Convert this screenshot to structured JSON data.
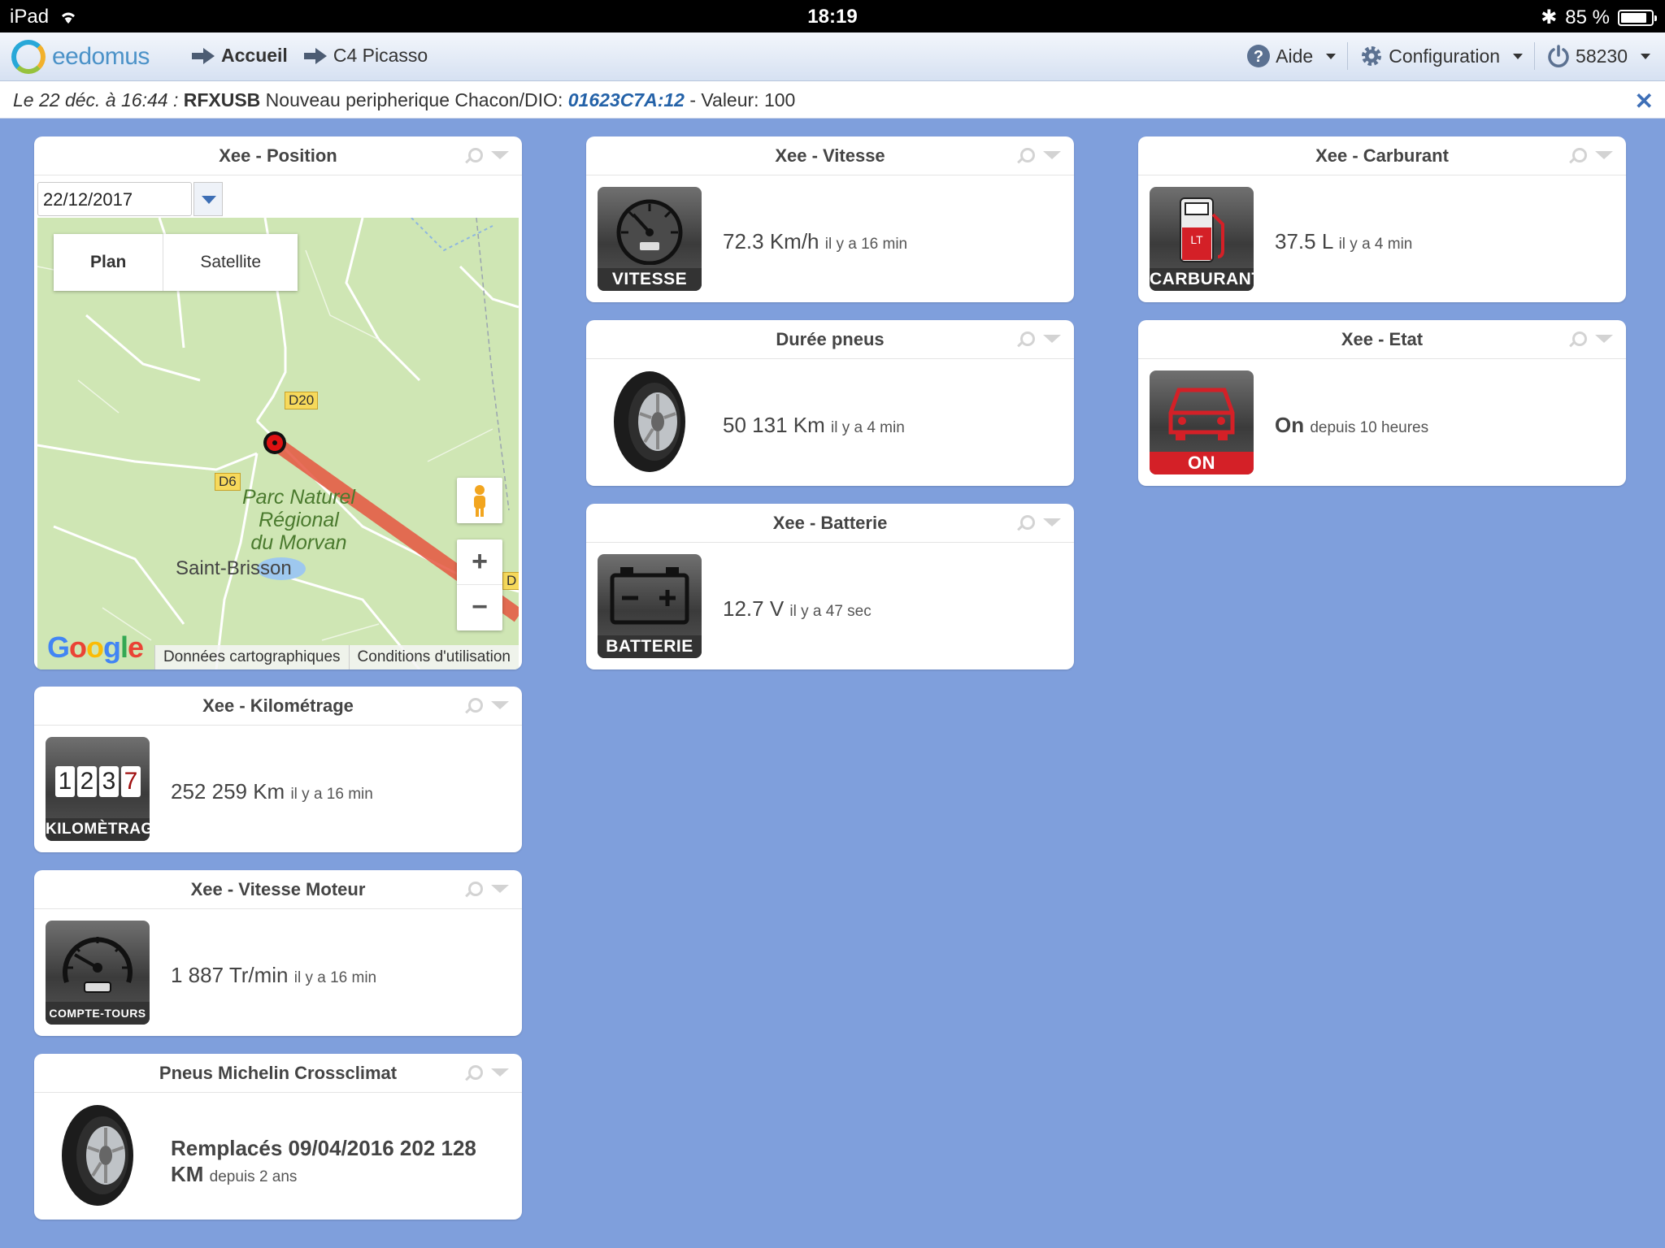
{
  "status_bar": {
    "device": "iPad",
    "time": "18:19",
    "battery": "85 %",
    "battery_level": 0.85
  },
  "header": {
    "logo_text": "eedomus",
    "breadcrumb": [
      {
        "label": "Accueil"
      },
      {
        "label": "C4 Picasso"
      }
    ],
    "help_label": "Aide",
    "config_label": "Configuration",
    "account_label": "58230"
  },
  "notification": {
    "date": "Le 22 déc. à 16:44 :",
    "source": "RFXUSB",
    "message": "Nouveau peripherique Chacon/DIO:",
    "code": "01623C7A:12",
    "value_text": "- Valeur: 100",
    "close": "✕"
  },
  "widgets": {
    "position": {
      "title": "Xee - Position",
      "date_value": "22/12/2017",
      "map_type_plan": "Plan",
      "map_type_satellite": "Satellite",
      "road_d20": "D20",
      "road_d6": "D6",
      "road_d": "D",
      "park_line1": "Parc Naturel",
      "park_line2": "Régional",
      "park_line3": "du Morvan",
      "town": "Saint-Brisson",
      "google": "Google",
      "map_data": "Données cartographiques",
      "terms": "Conditions d'utilisation",
      "zoom_in": "+",
      "zoom_out": "−"
    },
    "vitesse": {
      "title": "Xee - Vitesse",
      "caption": "VITESSE",
      "value": "72.3 Km/h",
      "since": "il y a 16 min"
    },
    "carburant": {
      "title": "Xee - Carburant",
      "caption": "CARBURANT",
      "value": "37.5 L",
      "since": "il y a 4 min"
    },
    "pneus": {
      "title": "Durée pneus",
      "value": "50 131 Km",
      "since": "il y a 4 min"
    },
    "etat": {
      "title": "Xee - Etat",
      "caption": "ON",
      "value": "On",
      "since": "depuis 10 heures"
    },
    "batterie": {
      "title": "Xee - Batterie",
      "caption": "BATTERIE",
      "value": "12.7 V",
      "since": "il y a 47 sec"
    },
    "kilometrage": {
      "title": "Xee - Kilométrage",
      "caption": "KILOMÈTRAGE",
      "digits": [
        "1",
        "2",
        "3",
        "7"
      ],
      "value": "252 259 Km",
      "since": "il y a 16 min"
    },
    "moteur": {
      "title": "Xee - Vitesse Moteur",
      "caption": "COMPTE-TOURS",
      "value": "1 887 Tr/min",
      "since": "il y a 16 min"
    },
    "michelin": {
      "title": "Pneus Michelin Crossclimat",
      "value_line1": "Remplacés 09/04/2016 202 128",
      "value_line2": "KM",
      "since": "depuis 2 ans"
    }
  },
  "colors": {
    "background": "#7f9fdc",
    "accent": "#2462a8",
    "on_red": "#d42027"
  }
}
